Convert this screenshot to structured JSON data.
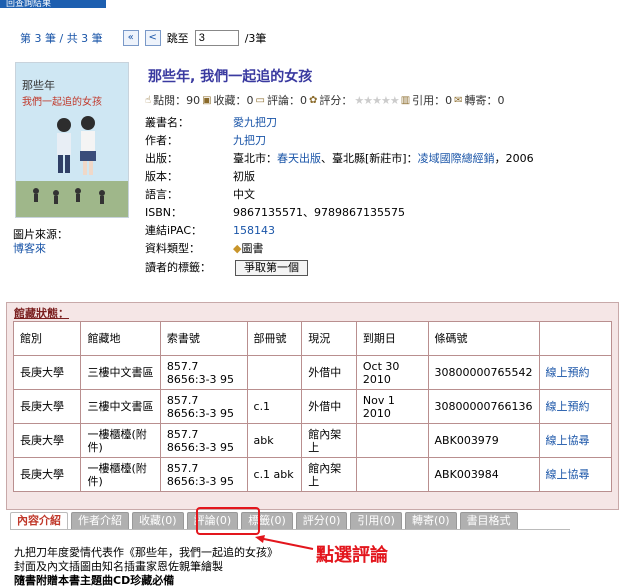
{
  "top_button": "回查詢結果",
  "pager": {
    "count_text": "第 3 筆 / 共 3 筆",
    "first_btn": "«",
    "prev_btn": "<",
    "jump_label": "跳至",
    "jump_value": "3",
    "total": "/3筆"
  },
  "cover": {
    "line1": "那些年",
    "line2": "我們一起追的女孩"
  },
  "image_source": {
    "label": "圖片來源：",
    "value": "博客來"
  },
  "book": {
    "title": "那些年, 我們一起追的女孩",
    "stats": {
      "views": "點閱：90",
      "favorites": "收藏：0",
      "comments": "評論：0",
      "rating_label": "評分：",
      "stars": "★★★★★",
      "cited": "引用：0",
      "forward": "轉寄：0"
    }
  },
  "info": {
    "series_label": "叢書名：",
    "series_value": "愛九把刀",
    "author_label": "作者：",
    "author_value": "九把刀",
    "publish_label": "出版：",
    "publish_p1": "臺北市：",
    "publish_link1": "春天出版",
    "publish_p2": "、臺北縣[新莊市]：",
    "publish_link2": "凌域國際總經銷",
    "publish_p3": "，2006",
    "edition_label": "版本：",
    "edition_value": "初版",
    "lang_label": "語言：",
    "lang_value": "中文",
    "isbn_label": "ISBN：",
    "isbn_value": "9867135571、9789867135575",
    "ipac_label": "連結iPAC：",
    "ipac_value": "158143",
    "type_label": "資料類型：",
    "type_value": "圖書",
    "tags_label": "讀者的標籤：",
    "tags_button": "爭取第一個"
  },
  "holdings": {
    "title": "館藏狀態：",
    "headers": [
      "館別",
      "館藏地",
      "索書號",
      "部冊號",
      "現況",
      "到期日",
      "條碼號",
      ""
    ],
    "rows": [
      [
        "長庚大學",
        "三樓中文書區",
        "857.7 8656:3-3 95",
        "",
        "外借中",
        "Oct 30 2010",
        "30800000765542",
        "線上預約"
      ],
      [
        "長庚大學",
        "三樓中文書區",
        "857.7 8656:3-3 95",
        "c.1",
        "外借中",
        "Nov 1 2010",
        "30800000766136",
        "線上預約"
      ],
      [
        "長庚大學",
        "一樓櫃檯(附件)",
        "857.7 8656:3-3 95",
        "abk",
        "館內架上",
        "",
        "ABK003979",
        "線上協尋"
      ],
      [
        "長庚大學",
        "一樓櫃檯(附件)",
        "857.7 8656:3-3 95",
        "c.1 abk",
        "館內架上",
        "",
        "ABK003984",
        "線上協尋"
      ]
    ]
  },
  "tabs": [
    "內容介紹",
    "作者介紹",
    "收藏(0)",
    "評論(0)",
    "標籤(0)",
    "評分(0)",
    "引用(0)",
    "轉寄(0)",
    "書目格式"
  ],
  "callout": "點選評論",
  "intro": {
    "line1": "九把刀年度愛情代表作《那些年，我們一起追的女孩》",
    "line2": "封面及內文插圖由知名插畫家恩佐親筆繪製",
    "line3": "隨書附贈本書主題曲CD珍藏必備"
  }
}
